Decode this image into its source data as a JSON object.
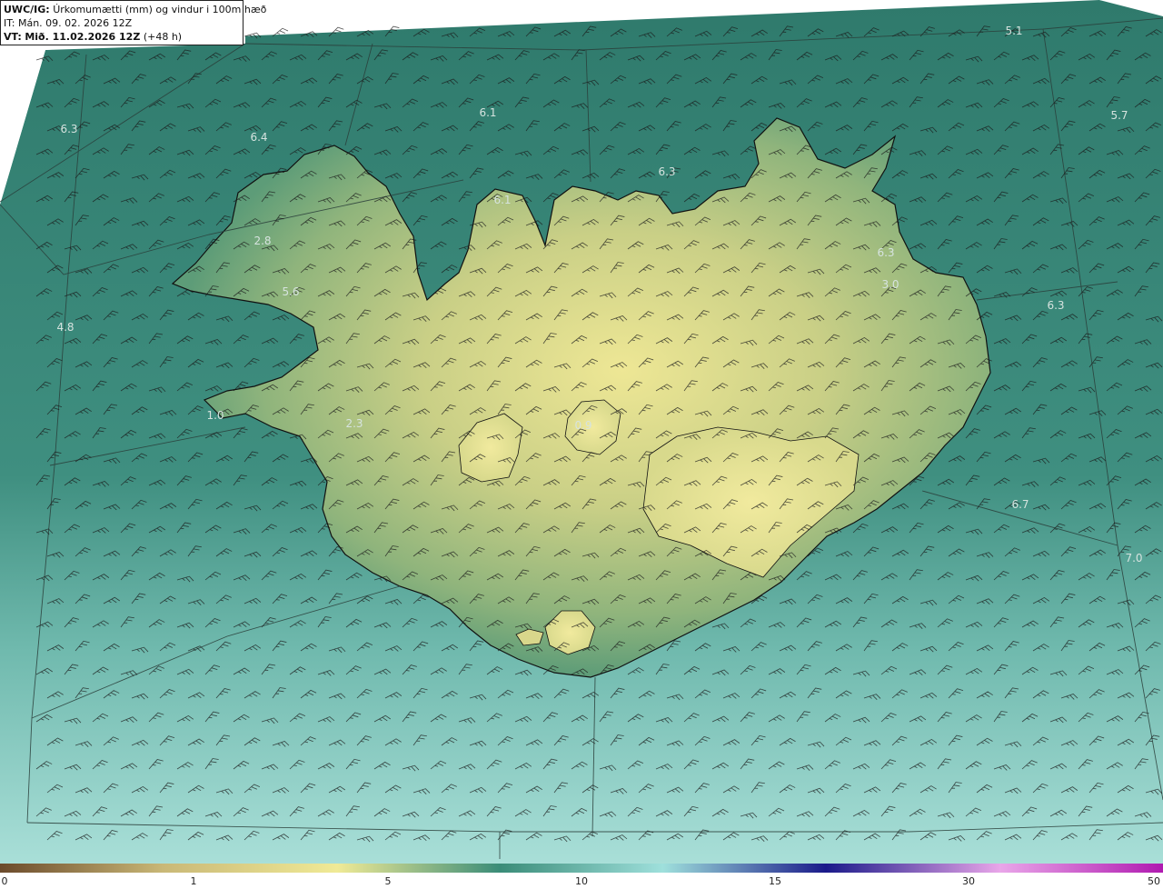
{
  "header": {
    "model": "UWC/IG:",
    "title": "Úrkomumætti (mm) og vindur i 100m hæð",
    "it_prefix": "IT:",
    "it_value": "Mán. 09. 02. 2026 12Z",
    "vt_prefix": "VT:",
    "vt_value": "Mið. 11.02.2026 12Z",
    "vt_lead": "(+48 h)"
  },
  "map": {
    "background_color": "#2e7d6f",
    "land_color_low": "#e8e08a",
    "sea_color_south": "#a6dcd6",
    "coast_color": "#111111",
    "barb_color": "#1a1a1a",
    "value_labels": [
      "5.1",
      "6.1",
      "5.7",
      "6.3",
      "6.4",
      "6.3",
      "6.1",
      "2.8",
      "6.3",
      "3.0",
      "5.6",
      "6.3",
      "4.8",
      "1.0",
      "2.3",
      "0.9",
      "6.7",
      "7.0"
    ]
  },
  "colorbar": {
    "ticks": [
      "0",
      "1",
      "5",
      "10",
      "15",
      "30",
      "50"
    ],
    "colors": [
      "#6b4a2b",
      "#c9b877",
      "#f0ea96",
      "#3a8c78",
      "#9fe0dc",
      "#1a1a8a",
      "#e9a6e9",
      "#b01ab0"
    ]
  }
}
